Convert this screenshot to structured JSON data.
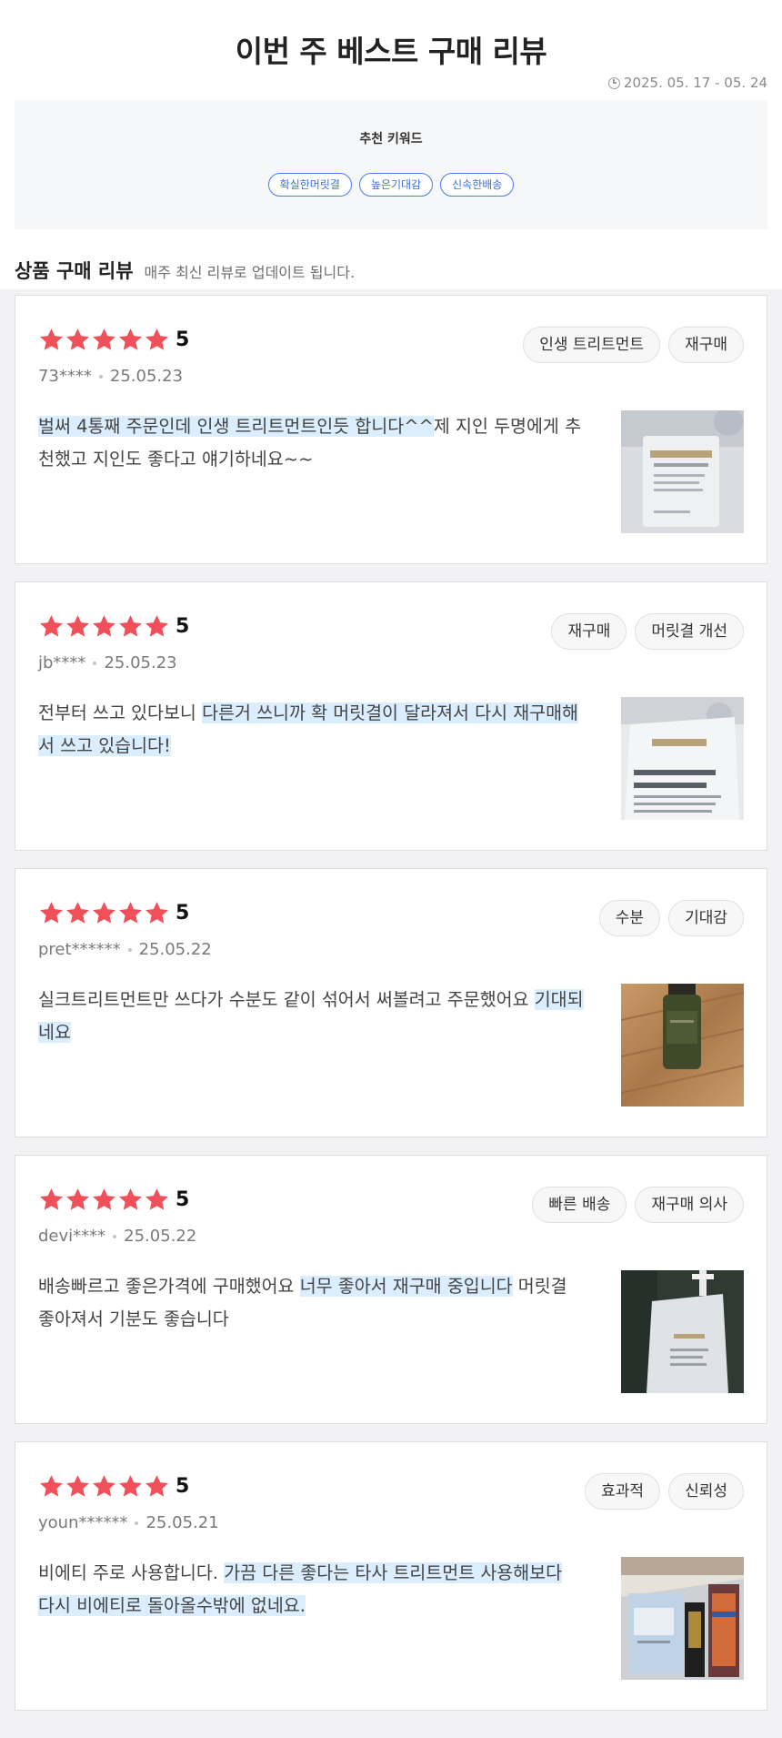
{
  "header": {
    "title": "이번 주 베스트 구매 리뷰",
    "date_range": "2025. 05. 17 - 05. 24"
  },
  "keywords": {
    "label": "추천 키워드",
    "items": [
      "확실한머릿결",
      "높은기대감",
      "신속한배송"
    ],
    "accent_color": "#3a6fe6"
  },
  "section": {
    "title": "상품 구매 리뷰",
    "subtitle": "매주 최신 리뷰로 업데이트 됩니다."
  },
  "star_color": "#f0505a",
  "highlight_color": "#dbeeff",
  "reviews": [
    {
      "rating": 5,
      "score": "5",
      "user": "73****",
      "date": "25.05.23",
      "tags": [
        "인생 트리트먼트",
        "재구매"
      ],
      "text_parts": [
        {
          "text": "벌써 4통째 주문인데 인생 트리트먼트인듯 합니다^^",
          "hl": true
        },
        {
          "text": "제 지인 두명에게 추천했고 지인도 좋다고 얘기하네요~~",
          "hl": false
        }
      ],
      "image": "product-pouch-front"
    },
    {
      "rating": 5,
      "score": "5",
      "user": "jb****",
      "date": "25.05.23",
      "tags": [
        "재구매",
        "머릿결 개선"
      ],
      "text_parts": [
        {
          "text": "전부터 쓰고 있다보니 ",
          "hl": false
        },
        {
          "text": "다른거 쓰니까 확 머릿결이 달라져서 다시 재구매해서 쓰고 있습니다!",
          "hl": true
        }
      ],
      "image": "product-pouch-label"
    },
    {
      "rating": 5,
      "score": "5",
      "user": "pret******",
      "date": "25.05.22",
      "tags": [
        "수분",
        "기대감"
      ],
      "text_parts": [
        {
          "text": "실크트리트먼트만 쓰다가 수분도 같이 섞어서 써볼려고 주문했어요 ",
          "hl": false
        },
        {
          "text": "기대되네요",
          "hl": true
        }
      ],
      "image": "green-bottle-on-wood-floor"
    },
    {
      "rating": 5,
      "score": "5",
      "user": "devi****",
      "date": "25.05.22",
      "tags": [
        "빠른 배송",
        "재구매 의사"
      ],
      "text_parts": [
        {
          "text": "배송빠르고 좋은가격에 구매했어요 ",
          "hl": false
        },
        {
          "text": "너무 좋아서 재구매 중입니다",
          "hl": true
        },
        {
          "text": " 머릿결 좋아져서 기분도 좋습니다",
          "hl": false
        }
      ],
      "image": "pouch-with-pump-dark-background"
    },
    {
      "rating": 5,
      "score": "5",
      "user": "youn******",
      "date": "25.05.21",
      "tags": [
        "효과적",
        "신뢰성"
      ],
      "text_parts": [
        {
          "text": "비에티 주로 사용합니다. ",
          "hl": false
        },
        {
          "text": "가끔 다른 좋다는 타사 트리트먼트 사용해보다 다시 비에티로 돌아올수밖에 없네요.",
          "hl": true
        }
      ],
      "image": "products-on-shelf"
    }
  ]
}
